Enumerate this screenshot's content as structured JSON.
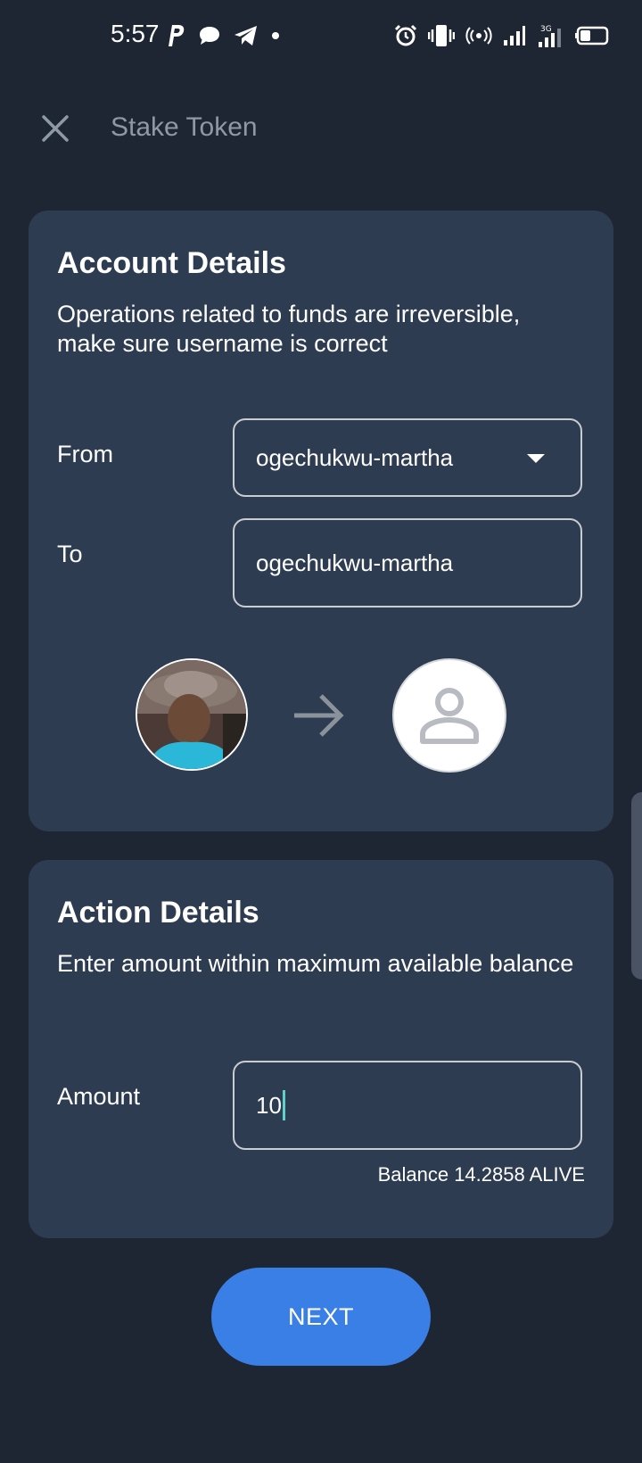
{
  "status_bar": {
    "time": "5:57",
    "left_icons": [
      "paypal-icon",
      "chat-bubble-icon",
      "telegram-icon",
      "dot-icon"
    ],
    "right_icons": [
      "alarm-icon",
      "vibrate-icon",
      "hotspot-icon",
      "signal-icon",
      "network-3g-icon",
      "battery-icon"
    ]
  },
  "header": {
    "title": "Stake Token",
    "close_icon": "close-icon"
  },
  "account_details": {
    "title": "Account Details",
    "subtitle": "Operations related to funds are irreversible, make sure username is correct",
    "from_label": "From",
    "from_value": "ogechukwu-martha",
    "to_label": "To",
    "to_value": "ogechukwu-martha",
    "from_avatar": "user-photo",
    "arrow_icon": "arrow-right-icon",
    "to_avatar": "person-placeholder-icon"
  },
  "action_details": {
    "title": "Action Details",
    "subtitle": "Enter amount within maximum available balance",
    "amount_label": "Amount",
    "amount_value": "10",
    "balance_text": "Balance 14.2858 ALIVE"
  },
  "next_button": {
    "label": "NEXT"
  },
  "colors": {
    "background": "#1f2633",
    "card": "#2e3c51",
    "accent": "#3a7fe6",
    "cursor": "#5fd1c8",
    "muted_text": "#8f98a6"
  }
}
